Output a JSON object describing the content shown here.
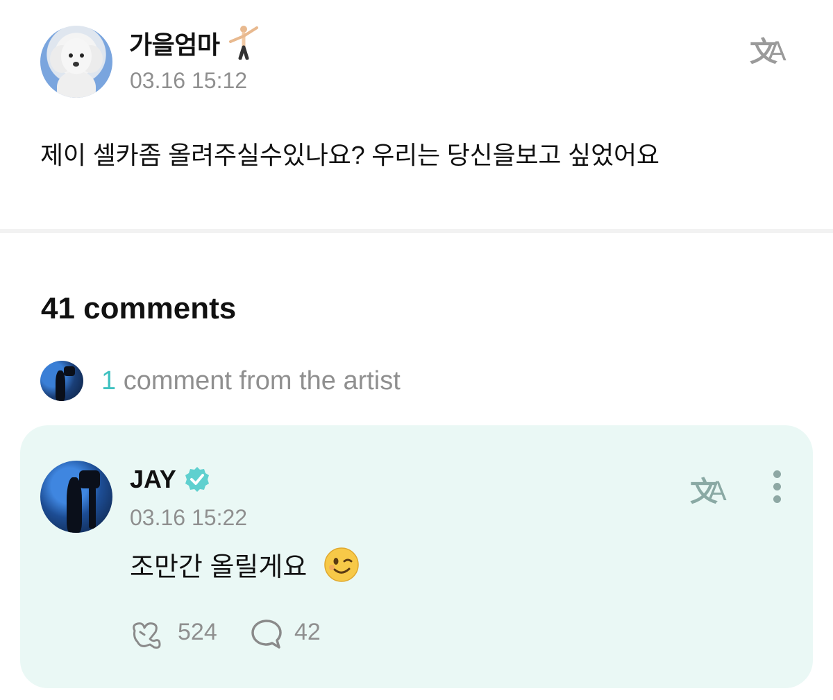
{
  "post": {
    "author_name": "가을엄마",
    "author_emoji": "cartwheel-emoji",
    "timestamp": "03.16 15:12",
    "body": "제이 셀카좀 올려주실수있나요? 우리는 당신을보고 싶었어요",
    "translate_icon": "translate-icon"
  },
  "comments": {
    "count_label": "41 comments",
    "artist_summary": {
      "count": "1",
      "label": " comment from the artist"
    }
  },
  "artist_comment": {
    "name": "JAY",
    "verified_icon": "verified-badge-icon",
    "timestamp": "03.16 15:22",
    "text": "조만간 올릴게요",
    "emoji": "winking-face-emoji",
    "likes": "524",
    "replies": "42",
    "colors": {
      "card_bg": "#eaf8f5",
      "accent": "#3fc1c0"
    }
  }
}
